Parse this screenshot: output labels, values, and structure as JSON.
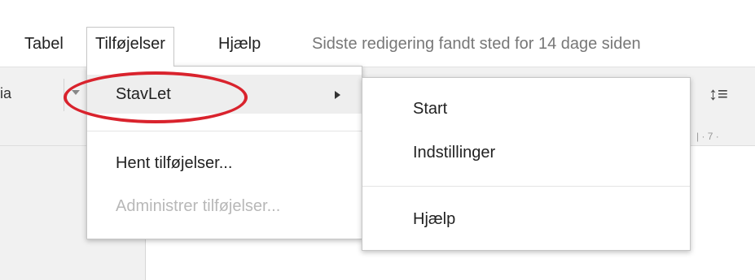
{
  "menubar": {
    "items": [
      {
        "label": "Tabel"
      },
      {
        "label": "Tilføjelser"
      },
      {
        "label": "Hjælp"
      }
    ],
    "last_edit": "Sidste redigering fandt sted for 14 dage siden"
  },
  "toolbar": {
    "font_label": "ia",
    "line_spacing_icon": "line-spacing-icon"
  },
  "ruler": {
    "mark": "7"
  },
  "addons_menu": {
    "items": [
      {
        "label": "StavLet",
        "has_submenu": true,
        "highlighted": true
      },
      {
        "label": "Hent tilføjelser..."
      },
      {
        "label": "Administrer tilføjelser...",
        "disabled": true
      }
    ]
  },
  "stavlet_submenu": {
    "items": [
      {
        "label": "Start"
      },
      {
        "label": "Indstillinger"
      },
      {
        "label": "Hjælp"
      }
    ]
  },
  "annotation": {
    "color": "#d9232d",
    "shape": "ellipse around StavLet"
  }
}
